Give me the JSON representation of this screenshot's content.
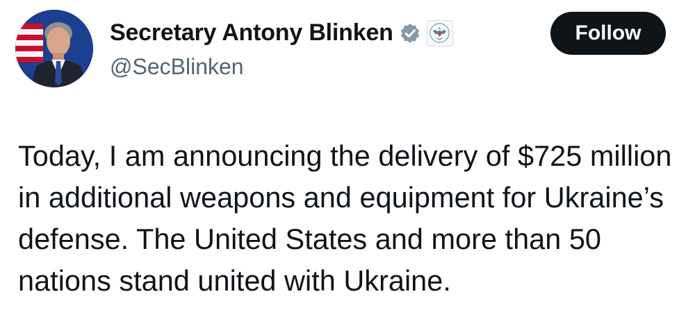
{
  "author": {
    "display_name": "Secretary Antony Blinken",
    "handle": "@SecBlinken",
    "avatar_icon": "profile-photo",
    "verified_icon": "verified-badge-icon",
    "org_badge_icon": "us-department-of-state-seal-icon"
  },
  "actions": {
    "follow_label": "Follow"
  },
  "tweet": {
    "text": "Today, I am announcing the delivery of $725 million in additional weapons and equipment for Ukraine’s defense. The United States and more than 50 nations stand united with Ukraine."
  },
  "colors": {
    "text": "#0f1419",
    "secondary_text": "#536471",
    "follow_bg": "#0f1419",
    "verified_badge": "#829aab"
  }
}
